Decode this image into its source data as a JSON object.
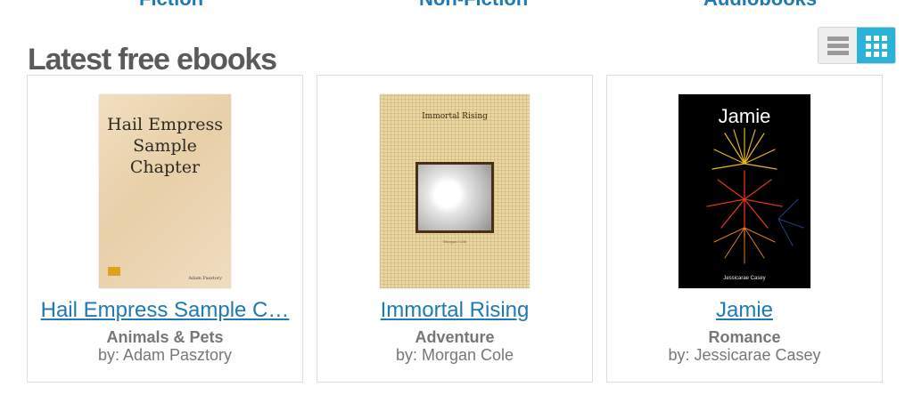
{
  "top_nav": {
    "fiction": "Fiction",
    "non_fiction": "Non-Fiction",
    "audiobooks": "Audiobooks"
  },
  "section_title": "Latest free ebooks",
  "view_toggle": {
    "active": "grid"
  },
  "books": [
    {
      "title": "Hail Empress Sample C…",
      "genre": "Animals & Pets",
      "author": "by: Adam Pasztory",
      "cover_text": "Hail Empress\nSample\nChapter",
      "cover_author": "Adam Pasztory"
    },
    {
      "title": "Immortal Rising",
      "genre": "Adventure",
      "author": "by: Morgan Cole",
      "cover_text": "Immortal Rising",
      "cover_author": "Morgan Cole"
    },
    {
      "title": "Jamie",
      "genre": "Romance",
      "author": "by: Jessicarae Casey",
      "cover_text": "Jamie",
      "cover_author": "Jessicarae Casey"
    }
  ],
  "colors": {
    "link": "#1f79b5",
    "heading": "#5a5a5a",
    "muted": "#777777",
    "toggle_active": "#29b3d9"
  }
}
